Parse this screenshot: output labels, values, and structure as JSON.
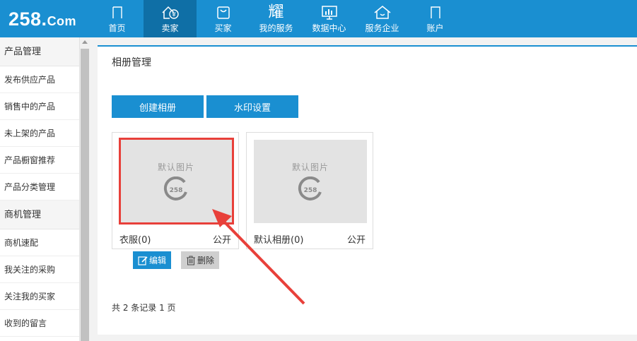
{
  "logo": {
    "main": "258.",
    "com": "Com"
  },
  "nav": [
    {
      "label": "首页",
      "icon": "home-icon",
      "active": false
    },
    {
      "label": "卖家",
      "icon": "seller-icon",
      "active": true
    },
    {
      "label": "买家",
      "icon": "buyer-bag-icon",
      "active": false
    },
    {
      "label": "我的服务",
      "icon": "service-glyph-icon",
      "active": false
    },
    {
      "label": "数据中心",
      "icon": "data-chart-icon",
      "active": false
    },
    {
      "label": "服务企业",
      "icon": "enterprise-home-icon",
      "active": false
    },
    {
      "label": "账户",
      "icon": "account-icon",
      "active": false
    }
  ],
  "nav_glyph_service": "耀",
  "sidebar": {
    "groups": [
      {
        "title": "产品管理",
        "items": [
          "发布供应产品",
          "销售中的产品",
          "未上架的产品",
          "产品橱窗推荐",
          "产品分类管理"
        ]
      },
      {
        "title": "商机管理",
        "items": [
          "商机速配",
          "我关注的采购",
          "关注我的买家",
          "收到的留言"
        ]
      }
    ]
  },
  "main": {
    "title": "相册管理",
    "create_button": "创建相册",
    "watermark_button": "水印设置",
    "albums": [
      {
        "name": "衣服(0)",
        "visibility": "公开",
        "placeholder": "默认图片",
        "brand": "258"
      },
      {
        "name": "默认相册(0)",
        "visibility": "公开",
        "placeholder": "默认图片",
        "brand": "258"
      }
    ],
    "edit_button": "编辑",
    "delete_button": "删除",
    "pagination": "共 2 条记录 1 页"
  },
  "colors": {
    "primary": "#1a8fd1",
    "active_nav": "#0f6fa6",
    "highlight": "#e8403a"
  }
}
